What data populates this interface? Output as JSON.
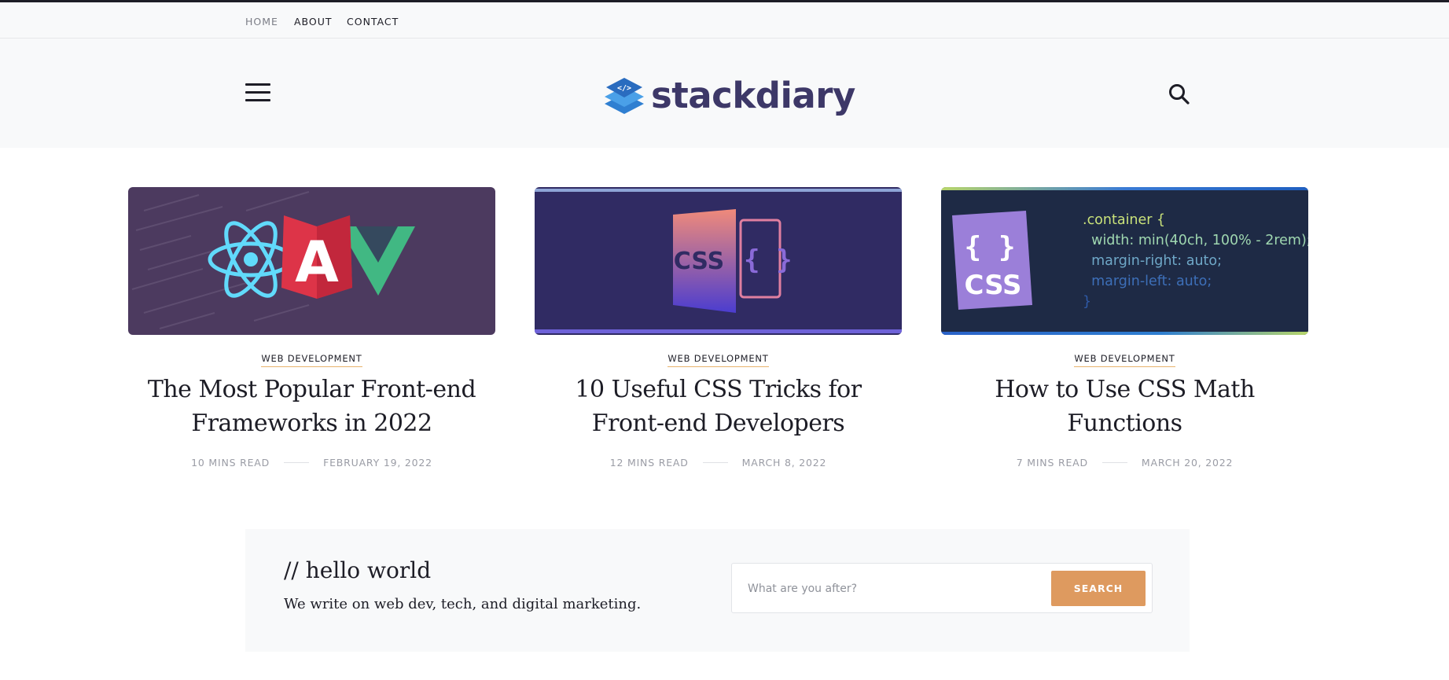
{
  "nav": {
    "links": [
      {
        "label": "HOME",
        "active": true
      },
      {
        "label": "ABOUT",
        "active": false
      },
      {
        "label": "CONTACT",
        "active": false
      }
    ]
  },
  "header": {
    "logo_text": "stackdiary",
    "menu_icon": "hamburger-menu-icon",
    "search_icon": "search-icon"
  },
  "cards": [
    {
      "category": "WEB DEVELOPMENT",
      "title": "The Most Popular Front-end Frameworks in 2022",
      "read_time": "10 MINS READ",
      "date": "FEBRUARY 19, 2022",
      "thumb_letter": "A"
    },
    {
      "category": "WEB DEVELOPMENT",
      "title": "10 Useful CSS Tricks for Front-end Developers",
      "read_time": "12 MINS READ",
      "date": "MARCH 8, 2022",
      "thumb_css": "CSS",
      "thumb_braces": "{ }"
    },
    {
      "category": "WEB DEVELOPMENT",
      "title": "How to Use CSS Math Functions",
      "read_time": "7 MINS READ",
      "date": "MARCH 20, 2022",
      "thumb_badge_braces": "{ }",
      "thumb_badge_css": "CSS",
      "code_lines": [
        ".container {",
        "  width: min(40ch, 100% - 2rem);",
        "  margin-right: auto;",
        "  margin-left: auto;",
        "}"
      ]
    }
  ],
  "hello": {
    "heading": "// hello world",
    "text": "We write on web dev, tech, and digital marketing.",
    "search_placeholder": "What are you after?",
    "search_button": "SEARCH"
  },
  "colors": {
    "brand": "#3d3868",
    "accent": "#de9a5f",
    "category_underline": "#e8b36c"
  }
}
